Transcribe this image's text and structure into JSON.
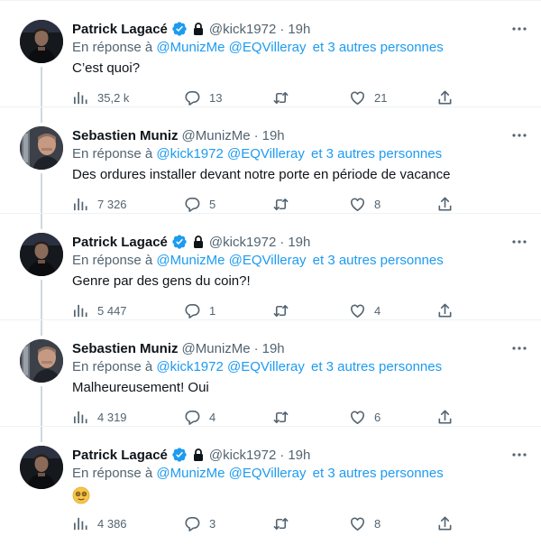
{
  "reply_prefix": "En réponse à",
  "tweets": [
    {
      "name": "Patrick Lagacé",
      "handle": "@kick1972",
      "time": "19h",
      "verified": true,
      "protected": true,
      "mentions": [
        "@MunizMe",
        "@EQVilleray"
      ],
      "others": "et 3 autres personnes",
      "text": "C’est quoi?",
      "views": "35,2 k",
      "replies": "13",
      "retweets": "",
      "likes": "21"
    },
    {
      "name": "Sebastien Muniz",
      "handle": "@MunizMe",
      "time": "19h",
      "verified": false,
      "protected": false,
      "mentions": [
        "@kick1972",
        "@EQVilleray"
      ],
      "others": "et 3 autres personnes",
      "text": "Des ordures installer devant notre porte en période de vacance",
      "views": "7 326",
      "replies": "5",
      "retweets": "",
      "likes": "8"
    },
    {
      "name": "Patrick Lagacé",
      "handle": "@kick1972",
      "time": "19h",
      "verified": true,
      "protected": true,
      "mentions": [
        "@MunizMe",
        "@EQVilleray"
      ],
      "others": "et 3 autres personnes",
      "text": "Genre par des gens du coin?!",
      "views": "5 447",
      "replies": "1",
      "retweets": "",
      "likes": "4"
    },
    {
      "name": "Sebastien Muniz",
      "handle": "@MunizMe",
      "time": "19h",
      "verified": false,
      "protected": false,
      "mentions": [
        "@kick1972",
        "@EQVilleray"
      ],
      "others": "et 3 autres personnes",
      "text": "Malheureusement! Oui",
      "views": "4 319",
      "replies": "4",
      "retweets": "",
      "likes": "6"
    },
    {
      "name": "Patrick Lagacé",
      "handle": "@kick1972",
      "time": "19h",
      "verified": true,
      "protected": true,
      "mentions": [
        "@MunizMe",
        "@EQVilleray"
      ],
      "others": "et 3 autres personnes",
      "text": "",
      "text_emoji": "face-with-spiral-eyes",
      "views": "4 386",
      "replies": "3",
      "retweets": "",
      "likes": "8"
    }
  ],
  "icons": {
    "views": "bar-chart-icon",
    "reply": "speech-bubble-icon",
    "retweet": "retweet-icon",
    "like": "heart-icon",
    "share": "share-icon",
    "more": "more-dots-icon",
    "verified": "verified-badge-icon",
    "protected": "lock-icon"
  },
  "colors": {
    "text": "#0f1419",
    "secondary": "#536471",
    "link": "#1d9bf0",
    "verified": "#1d9bf0",
    "divider": "#eff3f4",
    "thread": "#cfd9de"
  }
}
